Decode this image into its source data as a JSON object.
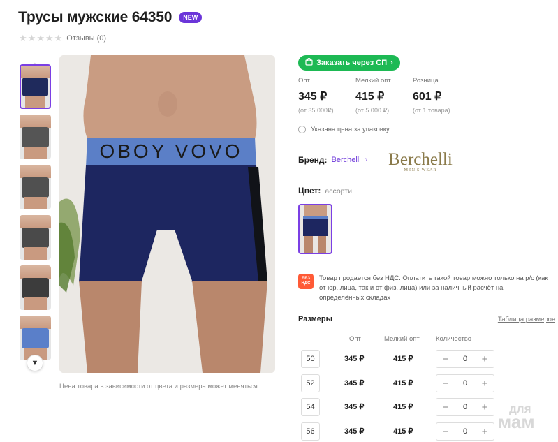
{
  "product": {
    "title": "Трусы мужские 64350",
    "badge": "NEW",
    "reviews": "Отзывы (0)",
    "stars": [
      "★",
      "★",
      "★",
      "★",
      "★"
    ]
  },
  "gallery": {
    "caption": "Цена товара в зависимости от цвета и размера может меняться",
    "up_icon": "chevron-up-icon",
    "down_icon": "chevron-down-icon",
    "thumbs": [
      {
        "garment": "#1f2a5c",
        "active": true
      },
      {
        "garment": "#555555",
        "active": false
      },
      {
        "garment": "#505050",
        "active": false
      },
      {
        "garment": "#4a4a4a",
        "active": false
      },
      {
        "garment": "#3c3c3c",
        "active": false
      },
      {
        "garment": "#5a7fc9",
        "active": false
      }
    ],
    "main_text": "OBOY VOVO"
  },
  "order": {
    "label": "Заказать через СП",
    "icon": "bag-icon",
    "color": "#1db954"
  },
  "prices": [
    {
      "label": "Опт",
      "value": "345 ₽",
      "sub": "(от 35 000₽)"
    },
    {
      "label": "Мелкий опт",
      "value": "415 ₽",
      "sub": "(от 5 000 ₽)"
    },
    {
      "label": "Розница",
      "value": "601 ₽",
      "sub": "(от 1 товара)"
    }
  ],
  "package_note": "Указана цена за упаковку",
  "brand": {
    "label": "Бренд:",
    "name": "Berchelli",
    "logo_text": "Berchelli",
    "logo_sub": "-MEN'S WEAR-"
  },
  "color": {
    "label": "Цвет:",
    "value": "ассорти"
  },
  "vat": {
    "badge_line1": "БЕЗ",
    "badge_line2": "НДС",
    "text": "Товар продается без НДС. Оплатить такой товар можно только на р/с (как от юр. лица, так и от физ. лица) или за наличный расчёт на определённых складах"
  },
  "sizes": {
    "title": "Размеры",
    "table_link": "Таблица размеров",
    "columns": [
      "Опт",
      "Мелкий опт",
      "Количество"
    ],
    "rows": [
      {
        "size": "50",
        "opt": "345 ₽",
        "small": "415 ₽",
        "qty": "0"
      },
      {
        "size": "52",
        "opt": "345 ₽",
        "small": "415 ₽",
        "qty": "0"
      },
      {
        "size": "54",
        "opt": "345 ₽",
        "small": "415 ₽",
        "qty": "0"
      },
      {
        "size": "56",
        "opt": "345 ₽",
        "small": "415 ₽",
        "qty": "0"
      }
    ],
    "minus": "−",
    "plus": "+"
  },
  "watermark": {
    "line1": "для",
    "line2": "мам"
  },
  "colors": {
    "accent": "#6b35d9",
    "badge_vat": "#ff5a36"
  }
}
